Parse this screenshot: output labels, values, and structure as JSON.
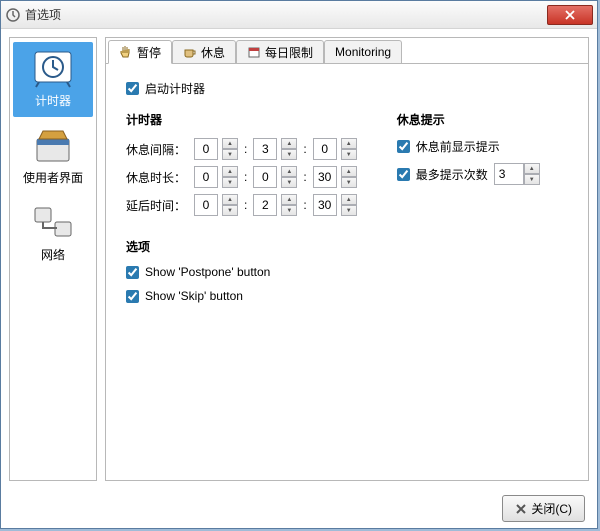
{
  "window": {
    "title": "首选项"
  },
  "sidebar": {
    "items": [
      {
        "label": "计时器"
      },
      {
        "label": "使用者界面"
      },
      {
        "label": "网络"
      }
    ]
  },
  "tabs": [
    {
      "label": "暂停"
    },
    {
      "label": "休息"
    },
    {
      "label": "每日限制"
    },
    {
      "label": "Monitoring"
    }
  ],
  "pane": {
    "enable_label": "启动计时器",
    "timer_section": "计时器",
    "hint_section": "休息提示",
    "interval_label": "休息间隔：",
    "duration_label": "休息时长：",
    "postpone_label": "延后时间：",
    "interval": {
      "h": "0",
      "m": "3",
      "s": "0"
    },
    "duration": {
      "h": "0",
      "m": "0",
      "s": "30"
    },
    "postpone": {
      "h": "0",
      "m": "2",
      "s": "30"
    },
    "hint_before_label": "休息前显示提示",
    "max_hint_label": "最多提示次数",
    "max_hint_value": "3",
    "options_section": "选项",
    "show_postpone_label": "Show 'Postpone' button",
    "show_skip_label": "Show 'Skip' button"
  },
  "footer": {
    "close_label": "关闭(C)"
  }
}
